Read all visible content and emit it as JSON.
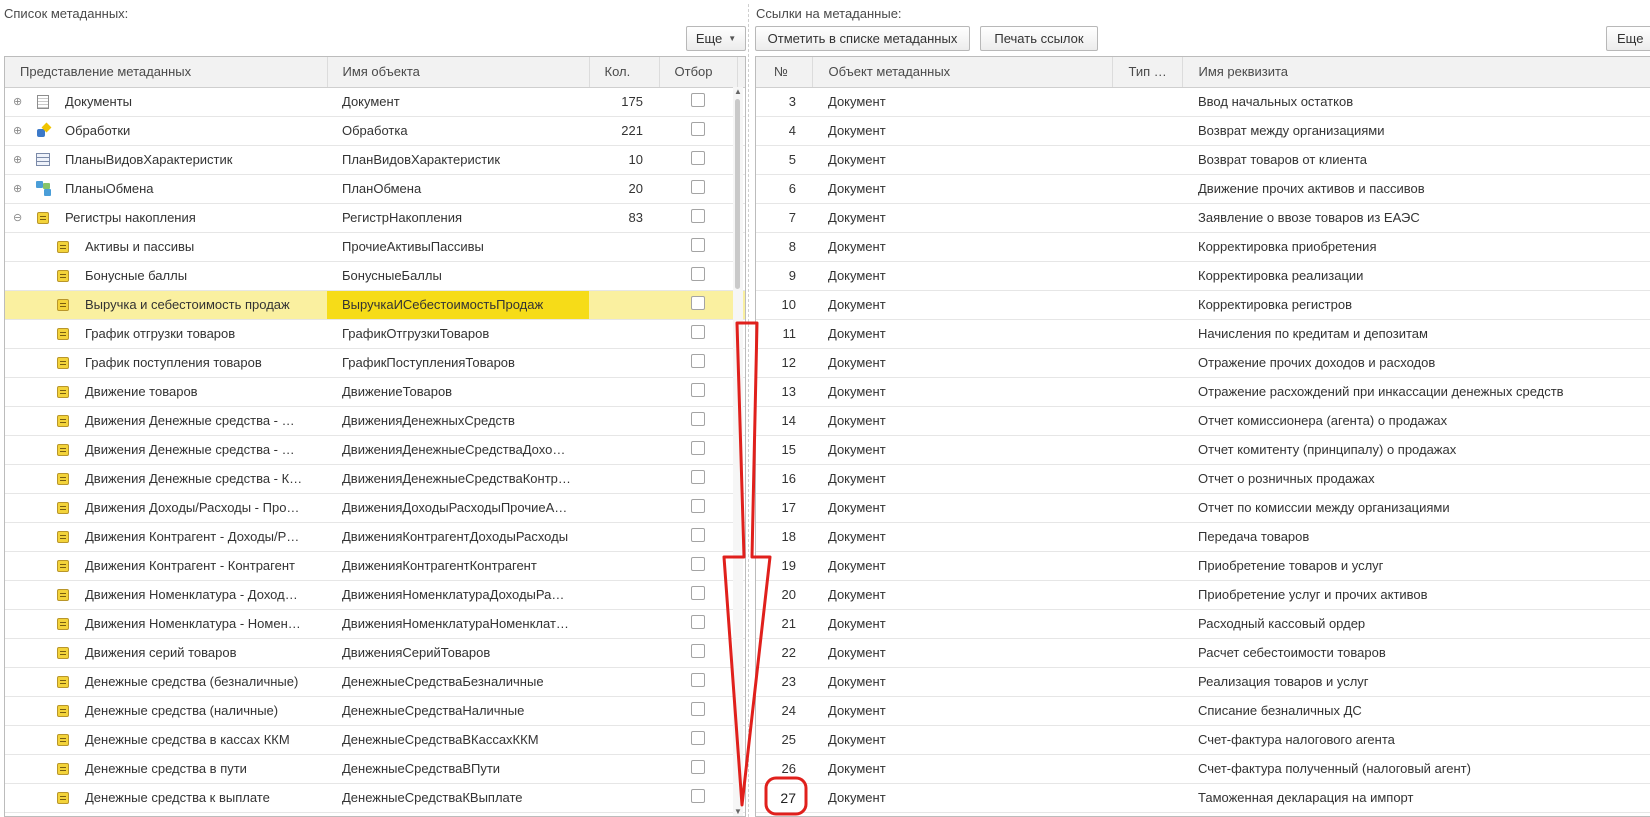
{
  "left_panel": {
    "title": "Список метаданных:",
    "more_button": "Еще",
    "columns": [
      "Представление метаданных",
      "Имя объекта",
      "Кол.",
      "Отбор"
    ],
    "rows": [
      {
        "level": 0,
        "expander": "⊕",
        "icon": "document-icon",
        "label": "Документы",
        "object": "Документ",
        "count": "175"
      },
      {
        "level": 0,
        "expander": "⊕",
        "icon": "data-processor-icon",
        "label": "Обработки",
        "object": "Обработка",
        "count": "221"
      },
      {
        "level": 0,
        "expander": "⊕",
        "icon": "characteristic-types-icon",
        "label": "ПланыВидовХарактеристик",
        "object": "ПланВидовХарактеристик",
        "count": "10"
      },
      {
        "level": 0,
        "expander": "⊕",
        "icon": "exchange-plan-icon",
        "label": "ПланыОбмена",
        "object": "ПланОбмена",
        "count": "20"
      },
      {
        "level": 0,
        "expander": "⊖",
        "icon": "accumulation-register-icon",
        "label": "Регистры накопления",
        "object": "РегистрНакопления",
        "count": "83"
      },
      {
        "level": 1,
        "icon": "accumulation-register-icon",
        "label": "Активы и пассивы",
        "object": "ПрочиеАктивыПассивы",
        "count": ""
      },
      {
        "level": 1,
        "icon": "accumulation-register-icon",
        "label": "Бонусные баллы",
        "object": "БонусныеБаллы",
        "count": ""
      },
      {
        "level": 1,
        "icon": "accumulation-register-icon",
        "label": "Выручка и себестоимость продаж",
        "object": "ВыручкаИСебестоимостьПродаж",
        "count": "",
        "selected": true
      },
      {
        "level": 1,
        "icon": "accumulation-register-icon",
        "label": "График отгрузки товаров",
        "object": "ГрафикОтгрузкиТоваров",
        "count": ""
      },
      {
        "level": 1,
        "icon": "accumulation-register-icon",
        "label": "График поступления товаров",
        "object": "ГрафикПоступленияТоваров",
        "count": ""
      },
      {
        "level": 1,
        "icon": "accumulation-register-icon",
        "label": "Движение товаров",
        "object": "ДвижениеТоваров",
        "count": ""
      },
      {
        "level": 1,
        "icon": "accumulation-register-icon",
        "label": "Движения Денежные средства - …",
        "object": "ДвиженияДенежныхСредств",
        "count": ""
      },
      {
        "level": 1,
        "icon": "accumulation-register-icon",
        "label": "Движения Денежные средства - …",
        "object": "ДвиженияДенежныеСредстваДохо…",
        "count": ""
      },
      {
        "level": 1,
        "icon": "accumulation-register-icon",
        "label": "Движения Денежные средства - К…",
        "object": "ДвиженияДенежныеСредстваКонтр…",
        "count": ""
      },
      {
        "level": 1,
        "icon": "accumulation-register-icon",
        "label": "Движения Доходы/Расходы - Про…",
        "object": "ДвиженияДоходыРасходыПрочиеА…",
        "count": ""
      },
      {
        "level": 1,
        "icon": "accumulation-register-icon",
        "label": "Движения Контрагент - Доходы/Р…",
        "object": "ДвиженияКонтрагентДоходыРасходы",
        "count": ""
      },
      {
        "level": 1,
        "icon": "accumulation-register-icon",
        "label": "Движения Контрагент - Контрагент",
        "object": "ДвиженияКонтрагентКонтрагент",
        "count": ""
      },
      {
        "level": 1,
        "icon": "accumulation-register-icon",
        "label": "Движения Номенклатура - Доход…",
        "object": "ДвиженияНоменклатураДоходыРа…",
        "count": ""
      },
      {
        "level": 1,
        "icon": "accumulation-register-icon",
        "label": "Движения Номенклатура - Номен…",
        "object": "ДвиженияНоменклатураНоменклат…",
        "count": ""
      },
      {
        "level": 1,
        "icon": "accumulation-register-icon",
        "label": "Движения серий товаров",
        "object": "ДвиженияСерийТоваров",
        "count": ""
      },
      {
        "level": 1,
        "icon": "accumulation-register-icon",
        "label": "Денежные средства (безналичные)",
        "object": "ДенежныеСредстваБезналичные",
        "count": ""
      },
      {
        "level": 1,
        "icon": "accumulation-register-icon",
        "label": "Денежные средства (наличные)",
        "object": "ДенежныеСредстваНаличные",
        "count": ""
      },
      {
        "level": 1,
        "icon": "accumulation-register-icon",
        "label": "Денежные средства в кассах ККМ",
        "object": "ДенежныеСредстваВКассахККМ",
        "count": ""
      },
      {
        "level": 1,
        "icon": "accumulation-register-icon",
        "label": "Денежные средства в пути",
        "object": "ДенежныеСредстваВПути",
        "count": ""
      },
      {
        "level": 1,
        "icon": "accumulation-register-icon",
        "label": "Денежные средства к выплате",
        "object": "ДенежныеСредстваКВыплате",
        "count": ""
      }
    ]
  },
  "right_panel": {
    "title": "Ссылки на метаданные:",
    "mark_button": "Отметить в списке метаданных",
    "print_button": "Печать ссылок",
    "more_button": "Еще",
    "columns": [
      "№",
      "Объект метаданных",
      "Тип …",
      "Имя реквизита"
    ],
    "rows": [
      {
        "n": "3",
        "object": "Документ",
        "type": "",
        "name": "Ввод начальных остатков"
      },
      {
        "n": "4",
        "object": "Документ",
        "type": "",
        "name": "Возврат между организациями"
      },
      {
        "n": "5",
        "object": "Документ",
        "type": "",
        "name": "Возврат товаров от клиента"
      },
      {
        "n": "6",
        "object": "Документ",
        "type": "",
        "name": "Движение прочих активов и пассивов"
      },
      {
        "n": "7",
        "object": "Документ",
        "type": "",
        "name": "Заявление о ввозе товаров из ЕАЭС"
      },
      {
        "n": "8",
        "object": "Документ",
        "type": "",
        "name": "Корректировка приобретения"
      },
      {
        "n": "9",
        "object": "Документ",
        "type": "",
        "name": "Корректировка реализации"
      },
      {
        "n": "10",
        "object": "Документ",
        "type": "",
        "name": "Корректировка регистров"
      },
      {
        "n": "11",
        "object": "Документ",
        "type": "",
        "name": "Начисления по кредитам и депозитам"
      },
      {
        "n": "12",
        "object": "Документ",
        "type": "",
        "name": "Отражение прочих доходов и расходов"
      },
      {
        "n": "13",
        "object": "Документ",
        "type": "",
        "name": "Отражение расхождений при инкассации денежных средств"
      },
      {
        "n": "14",
        "object": "Документ",
        "type": "",
        "name": "Отчет комиссионера (агента) о продажах"
      },
      {
        "n": "15",
        "object": "Документ",
        "type": "",
        "name": "Отчет комитенту (принципалу) о продажах"
      },
      {
        "n": "16",
        "object": "Документ",
        "type": "",
        "name": "Отчет о розничных продажах"
      },
      {
        "n": "17",
        "object": "Документ",
        "type": "",
        "name": "Отчет по комиссии между организациями"
      },
      {
        "n": "18",
        "object": "Документ",
        "type": "",
        "name": "Передача товаров"
      },
      {
        "n": "19",
        "object": "Документ",
        "type": "",
        "name": "Приобретение товаров и услуг"
      },
      {
        "n": "20",
        "object": "Документ",
        "type": "",
        "name": "Приобретение услуг и прочих активов"
      },
      {
        "n": "21",
        "object": "Документ",
        "type": "",
        "name": "Расходный кассовый ордер"
      },
      {
        "n": "22",
        "object": "Документ",
        "type": "",
        "name": "Расчет себестоимости товаров"
      },
      {
        "n": "23",
        "object": "Документ",
        "type": "",
        "name": "Реализация товаров и услуг"
      },
      {
        "n": "24",
        "object": "Документ",
        "type": "",
        "name": "Списание безналичных ДС"
      },
      {
        "n": "25",
        "object": "Документ",
        "type": "",
        "name": "Счет-фактура налогового агента"
      },
      {
        "n": "26",
        "object": "Документ",
        "type": "",
        "name": "Счет-фактура полученный (налоговый агент)"
      },
      {
        "n": "27",
        "object": "Документ",
        "type": "",
        "name": "Таможенная декларация на импорт"
      }
    ]
  },
  "annotation": {
    "color": "#e0201c",
    "highlighted_row": "27"
  },
  "colors": {
    "selected_row": "#faf0a0",
    "selected_cell": "#f6dc18",
    "header_bg": "#f2f2f2"
  }
}
